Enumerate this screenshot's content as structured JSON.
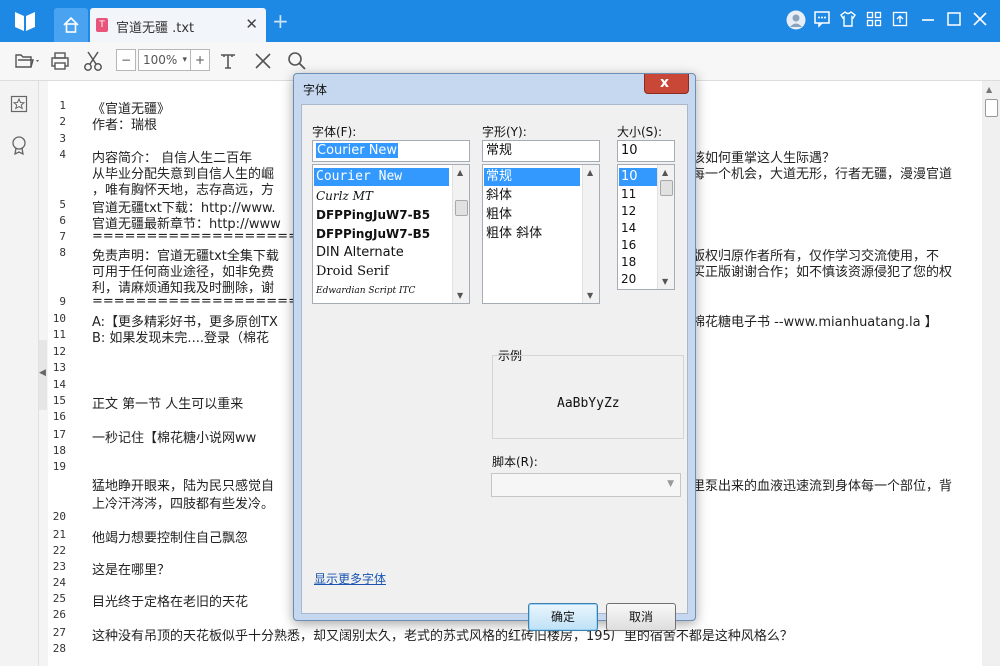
{
  "titlebar": {
    "doc_tab_title": "官道无疆 .txt",
    "doc_tab_icon_letter": "T",
    "close_glyph": "✕",
    "new_tab_glyph": "+"
  },
  "toolbar": {
    "zoom_minus": "−",
    "zoom_value": "100%",
    "zoom_caret": "▾",
    "zoom_plus": "+"
  },
  "document": {
    "lines": [
      {
        "n": "1",
        "text": "《官道无疆》"
      },
      {
        "n": "2",
        "text": "作者：瑞根"
      },
      {
        "n": "3",
        "text": ""
      },
      {
        "n": "4",
        "text": "内容简介：      自信人生二百年"
      },
      {
        "n": "",
        "text": "从毕业分配失意到自信人生的崛"
      },
      {
        "n": "",
        "text": "，唯有胸怀天地，志存高远，方"
      },
      {
        "n": "5",
        "text": "官道无疆txt下载：http://www."
      },
      {
        "n": "6",
        "text": "官道无疆最新章节：http://www"
      },
      {
        "n": "7",
        "text": "==========================="
      },
      {
        "n": "8",
        "text": "免责声明：官道无疆txt全集下载"
      },
      {
        "n": "",
        "text": "可用于任何商业途径，如非免费"
      },
      {
        "n": "",
        "text": "利，请麻烦通知我及时删除，谢"
      },
      {
        "n": "9",
        "text": "==========================="
      },
      {
        "n": "10",
        "text": "A:【更多精彩好书，更多原创TX"
      },
      {
        "n": "11",
        "text": "B: 如果发现未完....登录（棉花"
      },
      {
        "n": "12",
        "text": ""
      },
      {
        "n": "13",
        "text": ""
      },
      {
        "n": "14",
        "text": ""
      },
      {
        "n": "15",
        "text": "正文 第一节 人生可以重来"
      },
      {
        "n": "16",
        "text": ""
      },
      {
        "n": "17",
        "text": "    一秒记住【棉花糖小说网ww"
      },
      {
        "n": "18",
        "text": ""
      },
      {
        "n": "19",
        "text": ""
      },
      {
        "n": "",
        "text": "猛地睁开眼来，陆为民只感觉自"
      },
      {
        "n": "",
        "text": "上冷汗涔涔，四肢都有些发冷。"
      },
      {
        "n": "20",
        "text": ""
      },
      {
        "n": "21",
        "text": "    他竭力想要控制住自己飘忽"
      },
      {
        "n": "22",
        "text": ""
      },
      {
        "n": "23",
        "text": "    这是在哪里？"
      },
      {
        "n": "24",
        "text": ""
      },
      {
        "n": "25",
        "text": "    目光终于定格在老旧的天花"
      },
      {
        "n": "26",
        "text": ""
      },
      {
        "n": "27",
        "text": "    这种没有吊顶的天花板似乎十分熟悉，却又阔别太久，老式的苏式风格的红砖旧楼房，195厂里的宿舍不都是这种风格么？"
      },
      {
        "n": "28",
        "text": ""
      }
    ],
    "right_fragments": [
      {
        "row": 3,
        "text": "该如何重掌这人生际遇？"
      },
      {
        "row": 4,
        "text": "每一个机会，大道无形，行者无疆，漫漫官道"
      },
      {
        "row": 9,
        "text": "版权归原作者所有，仅作学习交流使用，不"
      },
      {
        "row": 10,
        "text": "买正版谢谢合作；如不慎该资源侵犯了您的权"
      },
      {
        "row": 13,
        "text": "棉花糖电子书 --www.mianhuatang.la 】"
      },
      {
        "row": 23,
        "text": "里泵出来的血液迅速流到身体每一个部位，背"
      }
    ]
  },
  "dialog": {
    "title": "字体",
    "font_label": "字体(F):",
    "font_value": "Courier New",
    "font_list": [
      "Courier New",
      "Curlz MT",
      "DFPPingJuW7-B5",
      "DFPPingJuW7-B5",
      "DIN Alternate",
      "Droid Serif",
      "Edwardian Script ITC"
    ],
    "style_label": "字形(Y):",
    "style_value": "常规",
    "style_list": [
      "常规",
      "斜体",
      "粗体",
      "粗体 斜体"
    ],
    "size_label": "大小(S):",
    "size_value": "10",
    "size_list": [
      "10",
      "11",
      "12",
      "14",
      "16",
      "18",
      "20"
    ],
    "sample_label": "示例",
    "sample_text": "AaBbYyZz",
    "script_label": "脚本(R):",
    "more_fonts_link": "显示更多字体",
    "ok_label": "确定",
    "cancel_label": "取消",
    "close_glyph": "x"
  }
}
